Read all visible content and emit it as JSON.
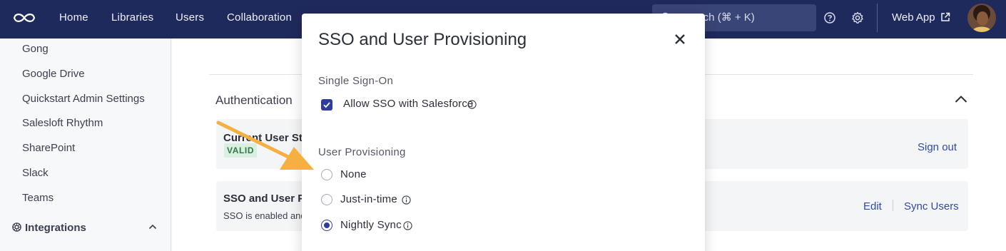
{
  "nav": {
    "links": [
      "Home",
      "Libraries",
      "Users",
      "Collaboration"
    ],
    "search_placeholder": "Search (⌘ + K)",
    "web_app_label": "Web App",
    "icons": [
      "logo-icon",
      "help-icon",
      "gear-icon",
      "external-link-icon"
    ],
    "bg_color": "#1f2a5c"
  },
  "sidebar": {
    "items": [
      "Gong",
      "Google Drive",
      "Quickstart Admin Settings",
      "Salesloft Rhythm",
      "SharePoint",
      "Slack",
      "Teams"
    ],
    "section_label": "Integrations"
  },
  "main": {
    "auth_title": "Authentication",
    "status_card": {
      "title": "Current User Status",
      "badge": "VALID",
      "action": "Sign out"
    },
    "sso_card": {
      "title": "SSO and User Provisioning",
      "desc": "SSO is enabled and",
      "actions": [
        "Edit",
        "Sync Users"
      ]
    }
  },
  "modal": {
    "title": "SSO and User Provisioning",
    "sso_section": "Single Sign-On",
    "sso_checkbox_label": "Allow SSO with Salesforce",
    "sso_checked": true,
    "provisioning_section": "User Provisioning",
    "provisioning_options": [
      "None",
      "Just-in-time",
      "Nightly Sync"
    ],
    "provisioning_selected": "Nightly Sync",
    "accent_color": "#303c9c"
  },
  "annotation": {
    "arrow_color": "#f5b041"
  }
}
